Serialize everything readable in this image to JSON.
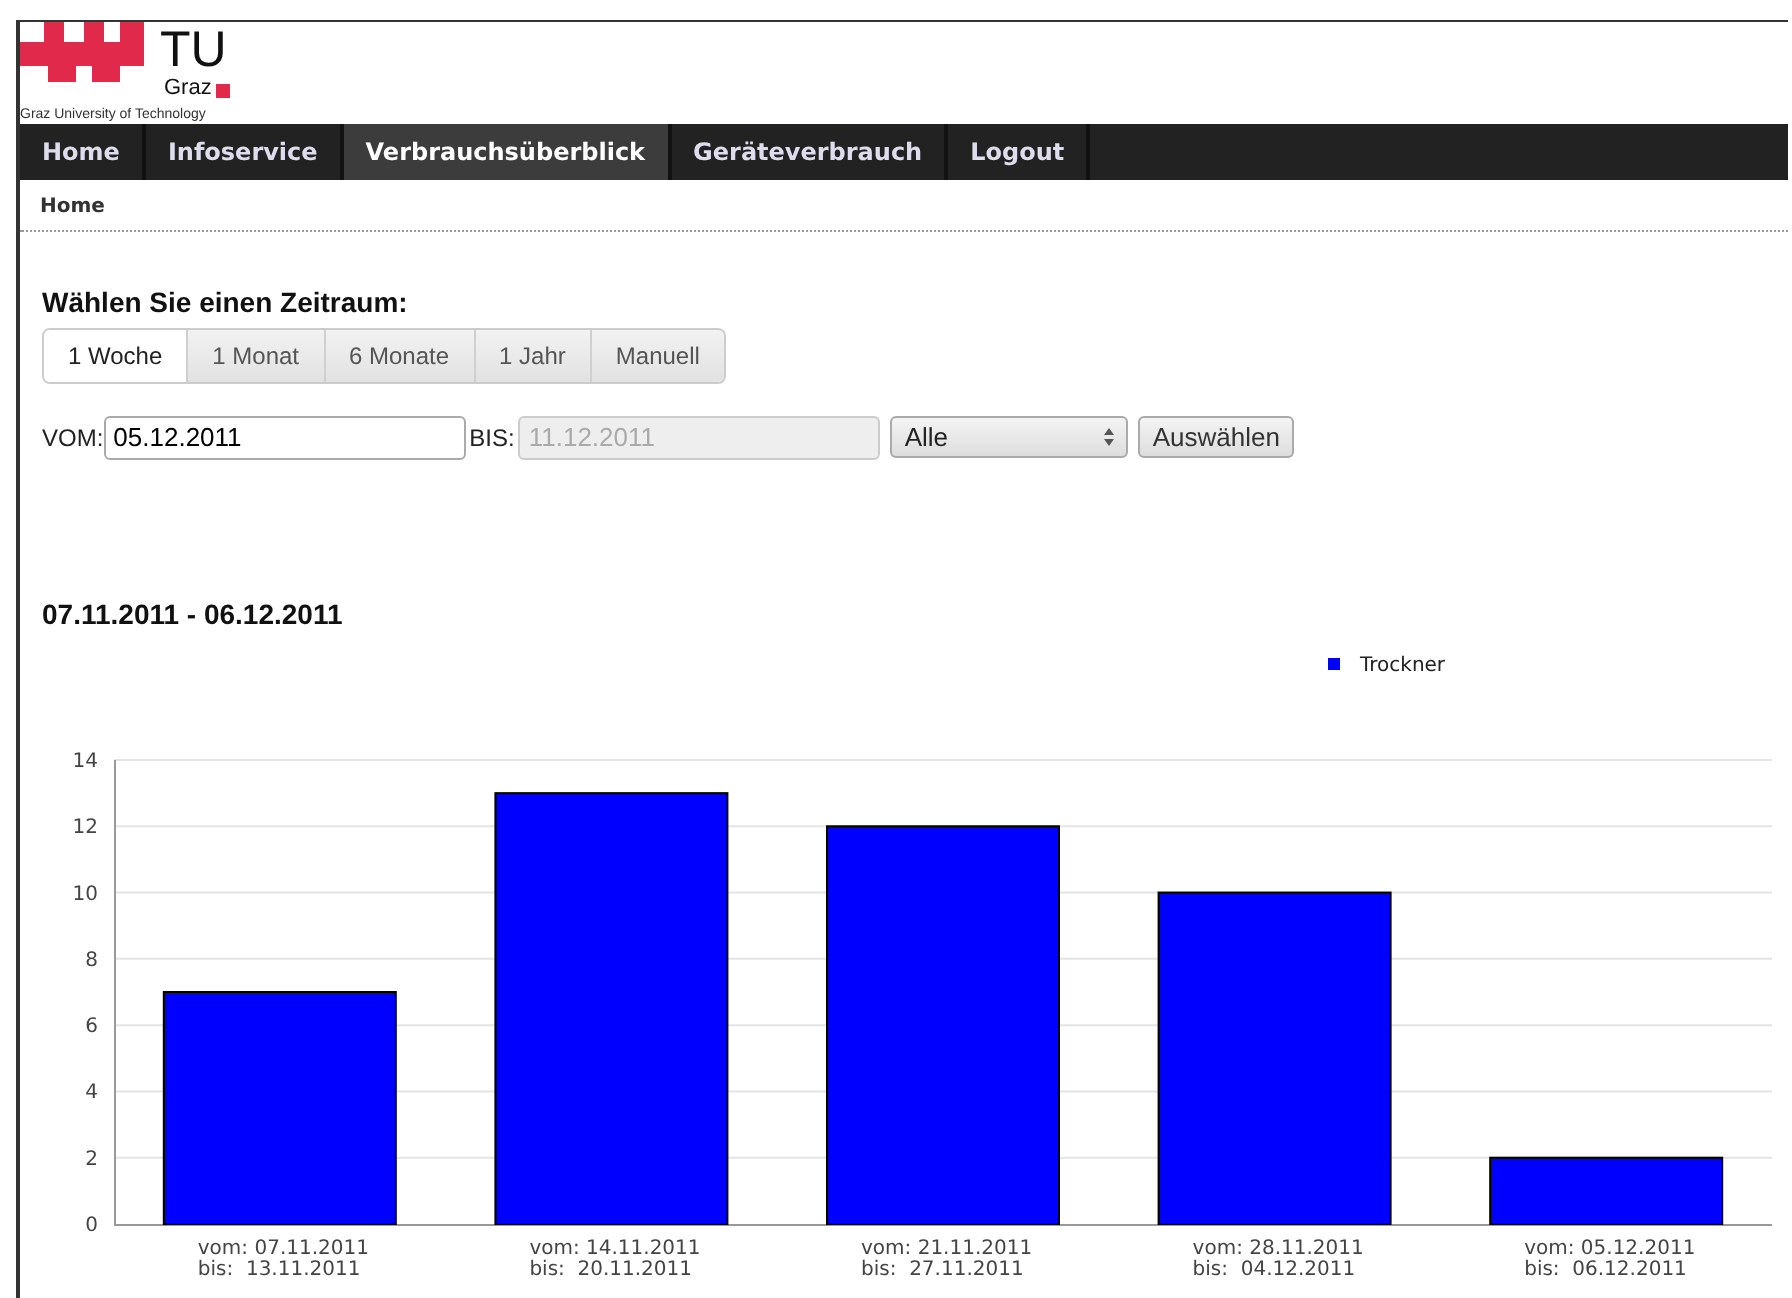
{
  "logo": {
    "mark": "TU",
    "city": "Graz",
    "subtitle": "Graz University of Technology"
  },
  "nav": [
    {
      "label": "Home",
      "selected": false
    },
    {
      "label": "Infoservice",
      "selected": false
    },
    {
      "label": "Verbrauchsüberblick",
      "selected": true
    },
    {
      "label": "Geräteverbrauch",
      "selected": false
    },
    {
      "label": "Logout",
      "selected": false
    }
  ],
  "breadcrumb": "Home",
  "period_heading": "Wählen Sie einen Zeitraum:",
  "period_tabs": [
    {
      "label": "1 Woche",
      "selected": true
    },
    {
      "label": "1 Monat",
      "selected": false
    },
    {
      "label": "6 Monate",
      "selected": false
    },
    {
      "label": "1 Jahr",
      "selected": false
    },
    {
      "label": "Manuell",
      "selected": false
    }
  ],
  "form": {
    "from_label": "VOM:",
    "from_value": "05.12.2011",
    "to_label": "BIS:",
    "to_value": "11.12.2011",
    "to_disabled": true,
    "select_value": "Alle",
    "button": "Auswählen"
  },
  "range_title": "07.11.2011 - 06.12.2011",
  "chart": {
    "chart_data": {
      "type": "bar",
      "categories": [
        "vom: 07.11.2011\nbis:  13.11.2011",
        "vom: 14.11.2011\nbis:  20.11.2011",
        "vom: 21.11.2011\nbis:  27.11.2011",
        "vom: 28.11.2011\nbis:  04.12.2011",
        "vom: 05.12.2011\nbis:  06.12.2011"
      ],
      "series": [
        {
          "name": "Trockner",
          "color": "#0000ff",
          "values": [
            7,
            13,
            12,
            10,
            2
          ]
        }
      ],
      "ylim": [
        0,
        14
      ],
      "grid": true,
      "yticks": [
        0,
        2,
        4,
        6,
        8,
        10,
        12,
        14
      ]
    }
  }
}
